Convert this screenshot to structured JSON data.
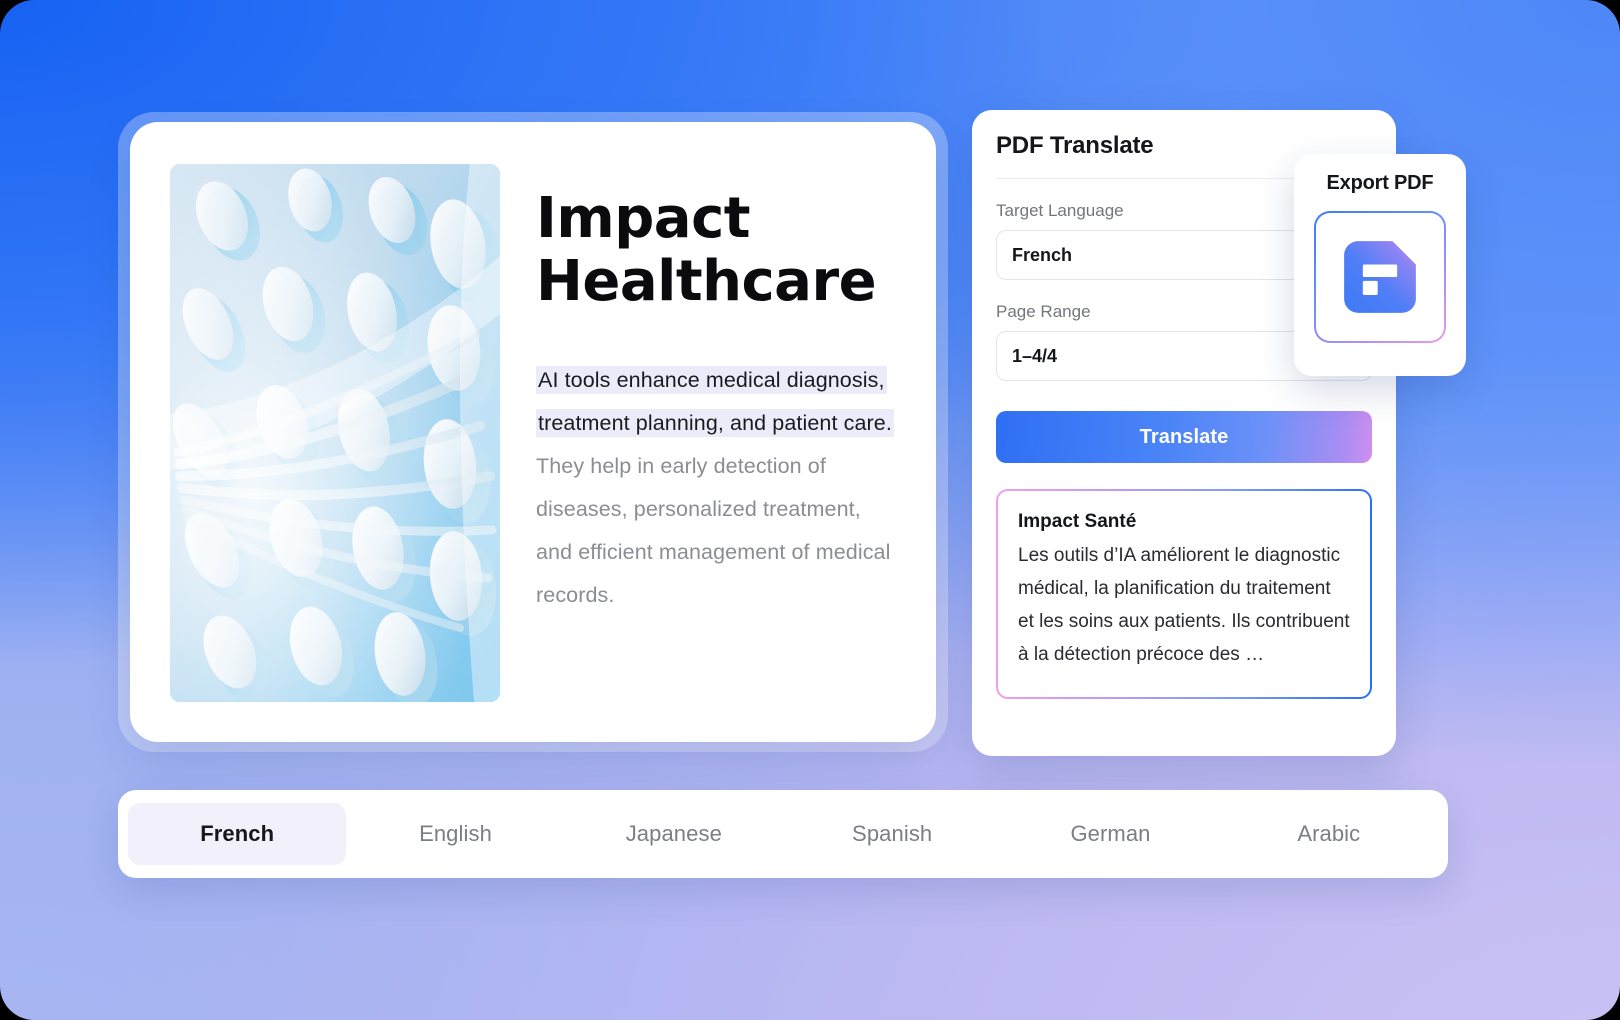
{
  "background": {
    "top_left_color": "#1762f3",
    "top_right_color": "#4d87f8",
    "bottom_left_color": "#a9b6f3",
    "bottom_right_color": "#c9c2f4"
  },
  "document": {
    "title": "Impact\nHealthcare",
    "title_line1": "Impact",
    "title_line2": "Healthcare",
    "highlighted_text": "AI tools enhance medical diagnosis, treatment planning, and patient care.",
    "rest_text": " They help in early detection of diseases, personalized treatment, and efficient management of medical records.",
    "thumbnail_name": "abstract-blue-lattice-artwork",
    "highlight_color": "#ecebfa"
  },
  "translate_panel": {
    "title": "PDF Translate",
    "target_language_label": "Target Language",
    "target_language_value": "French",
    "target_language_options": [
      "French",
      "English",
      "Japanese",
      "Spanish",
      "German",
      "Arabic"
    ],
    "page_range_label": "Page Range",
    "page_range_value": "1–4/4",
    "translate_button_label": "Translate",
    "result_title": "Impact Santé",
    "result_body": "Les outils d’IA améliorent le diagnostic médical, la planification du traitement et les soins aux patients. Ils contribuent à la détection précoce des …",
    "button_gradient_start": "#2f6ff4",
    "button_gradient_end": "#cf8ef0",
    "result_border_gradient_start": "#f49fe8",
    "result_border_gradient_end": "#2b6ef3"
  },
  "export_card": {
    "title": "Export PDF",
    "icon_name": "pdf-document-icon",
    "icon_gradient_start": "#3f7bf6",
    "icon_gradient_end": "#e79cee"
  },
  "language_bar": {
    "active_index": 0,
    "active_pill_color": "#f2f0fb",
    "tabs": [
      {
        "label": "French",
        "active": true
      },
      {
        "label": "English",
        "active": false
      },
      {
        "label": "Japanese",
        "active": false
      },
      {
        "label": "Spanish",
        "active": false
      },
      {
        "label": "German",
        "active": false
      },
      {
        "label": "Arabic",
        "active": false
      }
    ]
  }
}
